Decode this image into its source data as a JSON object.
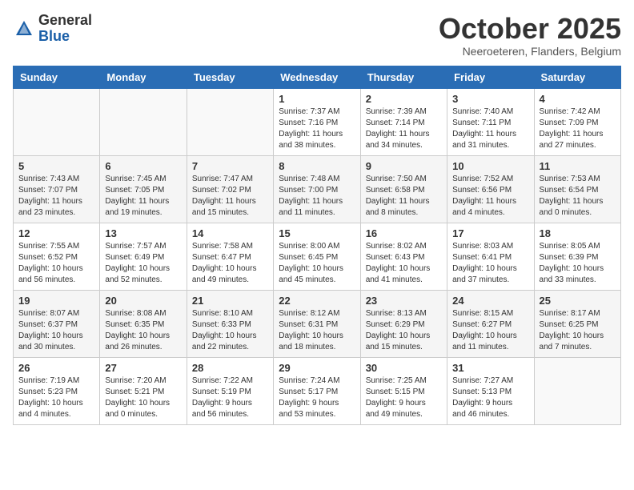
{
  "header": {
    "logo_general": "General",
    "logo_blue": "Blue",
    "month_title": "October 2025",
    "subtitle": "Neeroeteren, Flanders, Belgium"
  },
  "days_of_week": [
    "Sunday",
    "Monday",
    "Tuesday",
    "Wednesday",
    "Thursday",
    "Friday",
    "Saturday"
  ],
  "weeks": [
    [
      {
        "day": "",
        "info": ""
      },
      {
        "day": "",
        "info": ""
      },
      {
        "day": "",
        "info": ""
      },
      {
        "day": "1",
        "info": "Sunrise: 7:37 AM\nSunset: 7:16 PM\nDaylight: 11 hours\nand 38 minutes."
      },
      {
        "day": "2",
        "info": "Sunrise: 7:39 AM\nSunset: 7:14 PM\nDaylight: 11 hours\nand 34 minutes."
      },
      {
        "day": "3",
        "info": "Sunrise: 7:40 AM\nSunset: 7:11 PM\nDaylight: 11 hours\nand 31 minutes."
      },
      {
        "day": "4",
        "info": "Sunrise: 7:42 AM\nSunset: 7:09 PM\nDaylight: 11 hours\nand 27 minutes."
      }
    ],
    [
      {
        "day": "5",
        "info": "Sunrise: 7:43 AM\nSunset: 7:07 PM\nDaylight: 11 hours\nand 23 minutes."
      },
      {
        "day": "6",
        "info": "Sunrise: 7:45 AM\nSunset: 7:05 PM\nDaylight: 11 hours\nand 19 minutes."
      },
      {
        "day": "7",
        "info": "Sunrise: 7:47 AM\nSunset: 7:02 PM\nDaylight: 11 hours\nand 15 minutes."
      },
      {
        "day": "8",
        "info": "Sunrise: 7:48 AM\nSunset: 7:00 PM\nDaylight: 11 hours\nand 11 minutes."
      },
      {
        "day": "9",
        "info": "Sunrise: 7:50 AM\nSunset: 6:58 PM\nDaylight: 11 hours\nand 8 minutes."
      },
      {
        "day": "10",
        "info": "Sunrise: 7:52 AM\nSunset: 6:56 PM\nDaylight: 11 hours\nand 4 minutes."
      },
      {
        "day": "11",
        "info": "Sunrise: 7:53 AM\nSunset: 6:54 PM\nDaylight: 11 hours\nand 0 minutes."
      }
    ],
    [
      {
        "day": "12",
        "info": "Sunrise: 7:55 AM\nSunset: 6:52 PM\nDaylight: 10 hours\nand 56 minutes."
      },
      {
        "day": "13",
        "info": "Sunrise: 7:57 AM\nSunset: 6:49 PM\nDaylight: 10 hours\nand 52 minutes."
      },
      {
        "day": "14",
        "info": "Sunrise: 7:58 AM\nSunset: 6:47 PM\nDaylight: 10 hours\nand 49 minutes."
      },
      {
        "day": "15",
        "info": "Sunrise: 8:00 AM\nSunset: 6:45 PM\nDaylight: 10 hours\nand 45 minutes."
      },
      {
        "day": "16",
        "info": "Sunrise: 8:02 AM\nSunset: 6:43 PM\nDaylight: 10 hours\nand 41 minutes."
      },
      {
        "day": "17",
        "info": "Sunrise: 8:03 AM\nSunset: 6:41 PM\nDaylight: 10 hours\nand 37 minutes."
      },
      {
        "day": "18",
        "info": "Sunrise: 8:05 AM\nSunset: 6:39 PM\nDaylight: 10 hours\nand 33 minutes."
      }
    ],
    [
      {
        "day": "19",
        "info": "Sunrise: 8:07 AM\nSunset: 6:37 PM\nDaylight: 10 hours\nand 30 minutes."
      },
      {
        "day": "20",
        "info": "Sunrise: 8:08 AM\nSunset: 6:35 PM\nDaylight: 10 hours\nand 26 minutes."
      },
      {
        "day": "21",
        "info": "Sunrise: 8:10 AM\nSunset: 6:33 PM\nDaylight: 10 hours\nand 22 minutes."
      },
      {
        "day": "22",
        "info": "Sunrise: 8:12 AM\nSunset: 6:31 PM\nDaylight: 10 hours\nand 18 minutes."
      },
      {
        "day": "23",
        "info": "Sunrise: 8:13 AM\nSunset: 6:29 PM\nDaylight: 10 hours\nand 15 minutes."
      },
      {
        "day": "24",
        "info": "Sunrise: 8:15 AM\nSunset: 6:27 PM\nDaylight: 10 hours\nand 11 minutes."
      },
      {
        "day": "25",
        "info": "Sunrise: 8:17 AM\nSunset: 6:25 PM\nDaylight: 10 hours\nand 7 minutes."
      }
    ],
    [
      {
        "day": "26",
        "info": "Sunrise: 7:19 AM\nSunset: 5:23 PM\nDaylight: 10 hours\nand 4 minutes."
      },
      {
        "day": "27",
        "info": "Sunrise: 7:20 AM\nSunset: 5:21 PM\nDaylight: 10 hours\nand 0 minutes."
      },
      {
        "day": "28",
        "info": "Sunrise: 7:22 AM\nSunset: 5:19 PM\nDaylight: 9 hours\nand 56 minutes."
      },
      {
        "day": "29",
        "info": "Sunrise: 7:24 AM\nSunset: 5:17 PM\nDaylight: 9 hours\nand 53 minutes."
      },
      {
        "day": "30",
        "info": "Sunrise: 7:25 AM\nSunset: 5:15 PM\nDaylight: 9 hours\nand 49 minutes."
      },
      {
        "day": "31",
        "info": "Sunrise: 7:27 AM\nSunset: 5:13 PM\nDaylight: 9 hours\nand 46 minutes."
      },
      {
        "day": "",
        "info": ""
      }
    ]
  ]
}
